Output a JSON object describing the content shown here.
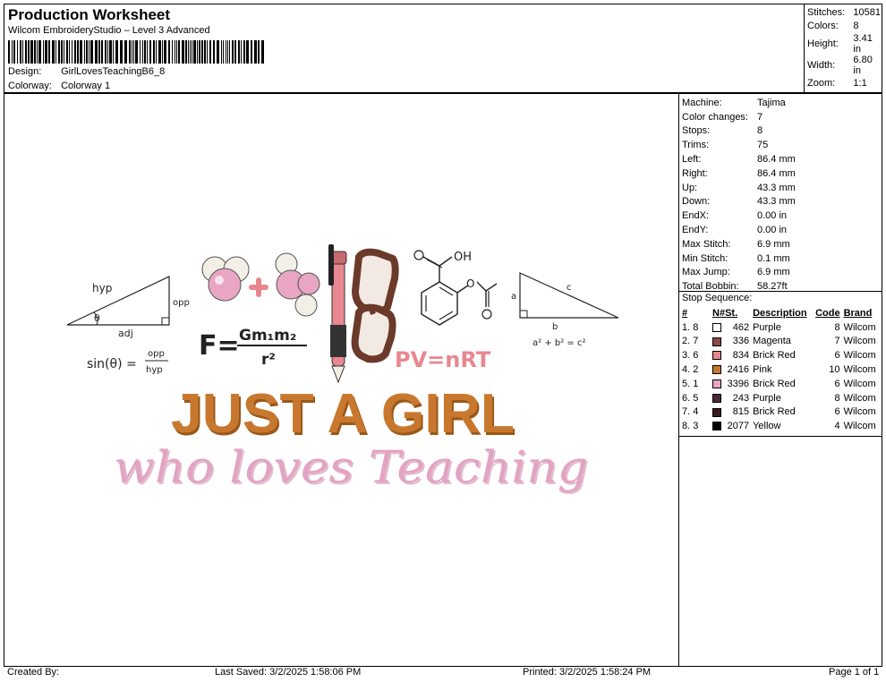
{
  "header": {
    "title": "Production Worksheet",
    "subtitle": "Wilcom EmbroideryStudio – Level 3 Advanced",
    "design_label": "Design:",
    "design_value": "GirlLovesTeachingB6_8",
    "colorway_label": "Colorway:",
    "colorway_value": "Colorway 1"
  },
  "stats": [
    {
      "label": "Stitches:",
      "value": "10581"
    },
    {
      "label": "Colors:",
      "value": "8"
    },
    {
      "label": "Height:",
      "value": "3.41 in"
    },
    {
      "label": "Width:",
      "value": "6.80 in"
    },
    {
      "label": "Zoom:",
      "value": "1:1"
    }
  ],
  "machine": [
    {
      "label": "Machine:",
      "value": "Tajima"
    },
    {
      "label": "Color changes:",
      "value": "7"
    },
    {
      "label": "Stops:",
      "value": "8"
    },
    {
      "label": "Trims:",
      "value": "75"
    },
    {
      "label": "Left:",
      "value": "86.4 mm"
    },
    {
      "label": "Right:",
      "value": "86.4 mm"
    },
    {
      "label": "Up:",
      "value": "43.3 mm"
    },
    {
      "label": "Down:",
      "value": "43.3 mm"
    },
    {
      "label": "EndX:",
      "value": "0.00 in"
    },
    {
      "label": "EndY:",
      "value": "0.00 in"
    },
    {
      "label": "Max Stitch:",
      "value": "6.9 mm"
    },
    {
      "label": "Min Stitch:",
      "value": "0.1 mm"
    },
    {
      "label": "Max Jump:",
      "value": "6.9 mm"
    },
    {
      "label": "Total Bobbin:",
      "value": "58.27ft"
    }
  ],
  "stop_sequence": {
    "title": "Stop Sequence:",
    "headers": [
      "#",
      "N#",
      "St.",
      "Description",
      "Code",
      "Brand"
    ],
    "rows": [
      {
        "seq": "1. 8",
        "color": "#ffffff",
        "st": "462",
        "desc": "Purple",
        "code": "8",
        "brand": "Wilcom"
      },
      {
        "seq": "2. 7",
        "color": "#8a4a48",
        "st": "336",
        "desc": "Magenta",
        "code": "7",
        "brand": "Wilcom"
      },
      {
        "seq": "3. 6",
        "color": "#e8878f",
        "st": "834",
        "desc": "Brick Red",
        "code": "6",
        "brand": "Wilcom"
      },
      {
        "seq": "4. 2",
        "color": "#c8782e",
        "st": "2416",
        "desc": "Pink",
        "code": "10",
        "brand": "Wilcom"
      },
      {
        "seq": "5. 1",
        "color": "#e8a6c4",
        "st": "3396",
        "desc": "Brick Red",
        "code": "6",
        "brand": "Wilcom"
      },
      {
        "seq": "6. 5",
        "color": "#4a2a38",
        "st": "243",
        "desc": "Purple",
        "code": "8",
        "brand": "Wilcom"
      },
      {
        "seq": "7. 4",
        "color": "#3a1a1a",
        "st": "815",
        "desc": "Brick Red",
        "code": "6",
        "brand": "Wilcom"
      },
      {
        "seq": "8. 3",
        "color": "#000000",
        "st": "2077",
        "desc": "Yellow",
        "code": "4",
        "brand": "Wilcom"
      }
    ]
  },
  "footer": {
    "created_by": "Created By:",
    "last_saved": "Last Saved: 3/2/2025 1:58:06 PM",
    "printed": "Printed: 3/2/2025 1:58:24 PM",
    "page": "Page 1 of 1"
  },
  "design": {
    "headline": "JUST A GIRL",
    "script_line": "who loves Teaching",
    "formula_gravity": "F=",
    "formula_gravity_num": "Gm₁m₂",
    "formula_gravity_den": "r²",
    "formula_gas": "PV=nRT",
    "trig_hyp": "hyp",
    "trig_opp": "opp",
    "trig_adj": "adj",
    "trig_theta": "θ",
    "trig_sin": "sin(θ) =",
    "trig_frac_num": "opp",
    "trig_frac_den": "hyp",
    "tri2_a": "a",
    "tri2_b": "b",
    "tri2_c": "c",
    "pythag": "a² + b² = c²",
    "chem_oh": "OH",
    "chem_o": "O",
    "colors": {
      "orange": "#c8782e",
      "orange_dark": "#9a5818",
      "pink": "#e3a3c2",
      "pink_dark": "#c47fa2",
      "rose": "#e8878f",
      "brown": "#6b3a2a",
      "ink": "#222222"
    }
  }
}
